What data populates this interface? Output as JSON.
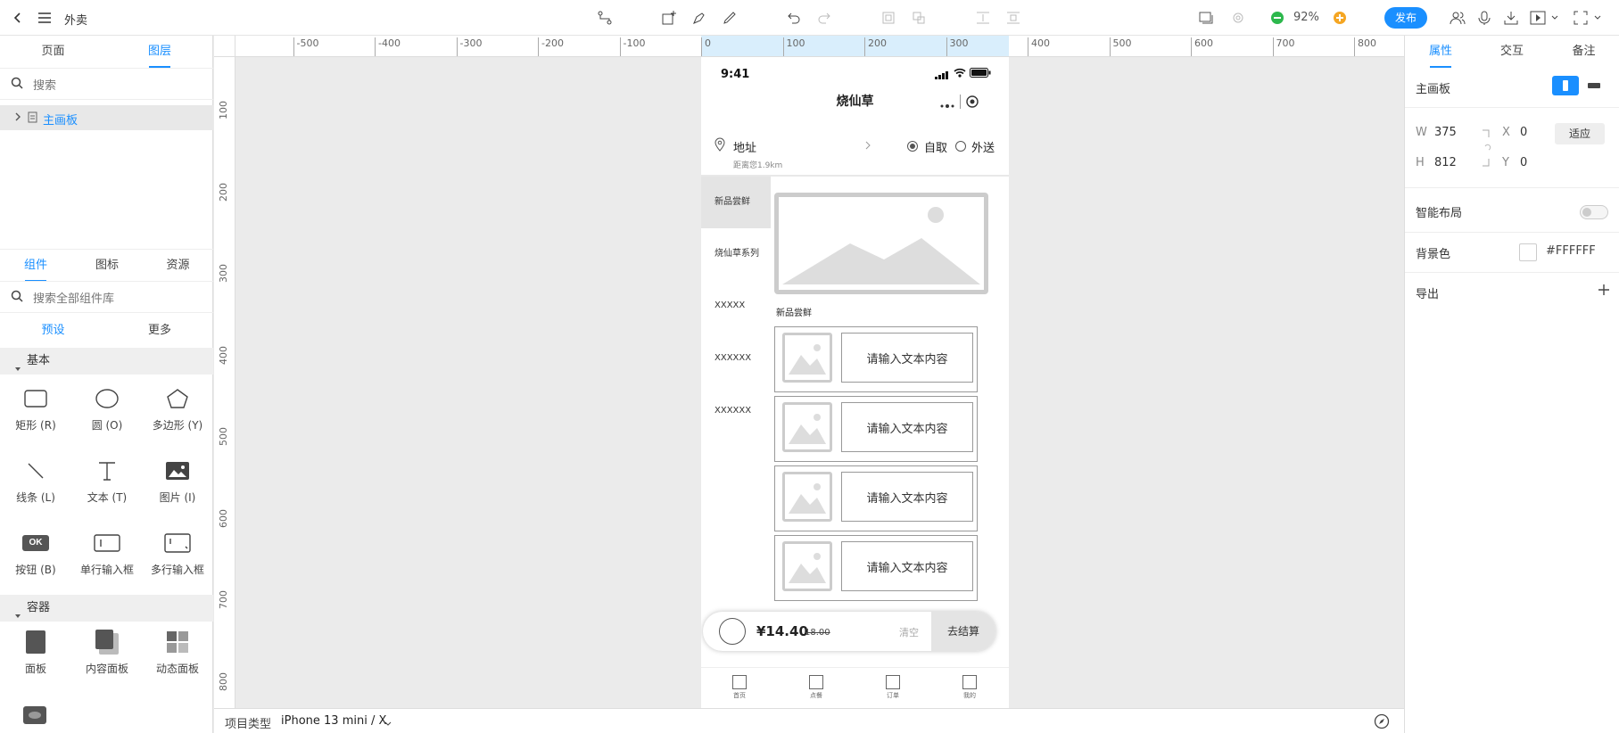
{
  "topbar": {
    "title": "外卖",
    "zoom": "92%",
    "publish_label": "发布"
  },
  "left": {
    "tabs": [
      "页面",
      "图层"
    ],
    "layer_search_placeholder": "搜索",
    "layer_item": "主画板",
    "lib_tabs": [
      "组件",
      "图标",
      "资源"
    ],
    "lib_search_placeholder": "搜索全部组件库",
    "subtabs": [
      "预设",
      "更多"
    ],
    "section_basic": "基本",
    "basic_items": [
      "矩形 (R)",
      "圆 (O)",
      "多边形 (Y)",
      "线条 (L)",
      "文本 (T)",
      "图片 (I)",
      "按钮 (B)",
      "单行输入框",
      "多行输入框"
    ],
    "ok_glyph": "OK",
    "section_container": "容器",
    "container_items": [
      "面板",
      "内容面板",
      "动态面板"
    ]
  },
  "ruler": {
    "h_labels": [
      "-500",
      "-400",
      "-300",
      "-200",
      "-100",
      "0",
      "100",
      "200",
      "300",
      "400",
      "500",
      "600",
      "700",
      "800"
    ],
    "v_labels": [
      "100",
      "200",
      "300",
      "400",
      "500",
      "600",
      "700",
      "800"
    ]
  },
  "phone": {
    "time": "9:41",
    "title": "烧仙草",
    "address_label": "地址",
    "distance": "距离您1.9km",
    "option_pickup": "自取",
    "option_delivery": "外送",
    "categories": [
      "新品尝鲜",
      "烧仙草系列",
      "XXXXX",
      "XXXXXX",
      "XXXXXX"
    ],
    "section_label": "新品尝鲜",
    "card_text": [
      "请输入文本内容",
      "请输入文本内容",
      "请输入文本内容",
      "请输入文本内容"
    ],
    "price": "¥14.40",
    "original_price": "18.00",
    "clear_label": "清空",
    "checkout_label": "去结算",
    "nav_items": [
      "首页",
      "点餐",
      "订单",
      "我的"
    ]
  },
  "bottombar": {
    "project_type_label": "项目类型",
    "device": "iPhone 13 mini / X"
  },
  "right": {
    "tabs": [
      "属性",
      "交互",
      "备注"
    ],
    "artboard_label": "主画板",
    "w_label": "W",
    "w_value": "375",
    "h_label": "H",
    "h_value": "812",
    "x_label": "X",
    "x_value": "0",
    "y_label": "Y",
    "y_value": "0",
    "fit_label": "适应",
    "smart_layout_label": "智能布局",
    "bg_label": "背景色",
    "bg_value": "#FFFFFF",
    "export_label": "导出",
    "accent": "#1a8fff"
  }
}
